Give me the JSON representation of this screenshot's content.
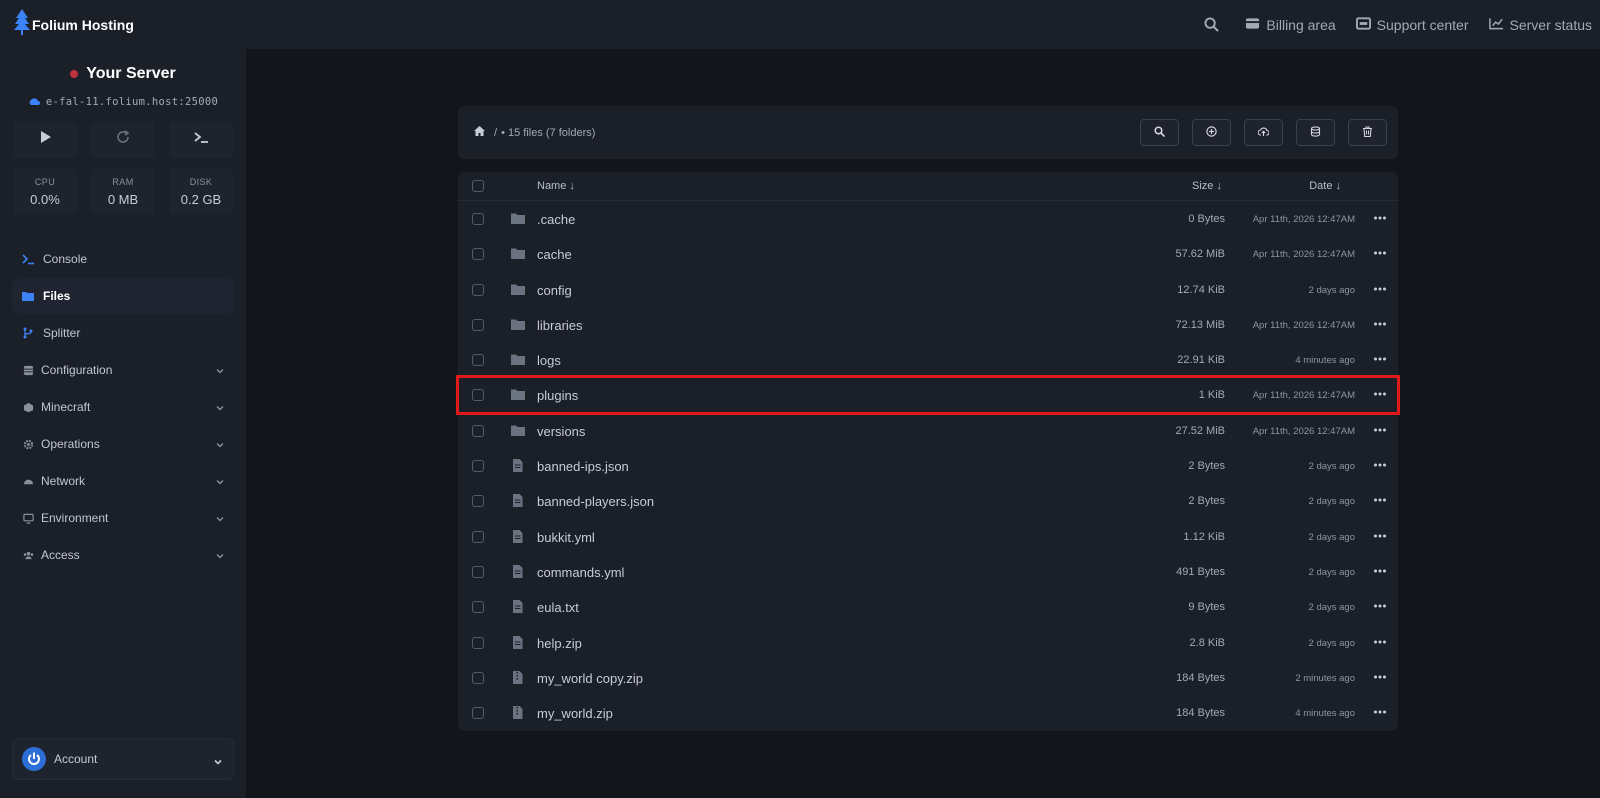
{
  "brand": {
    "name": "Folium Hosting",
    "accent_color": "#3b82f6"
  },
  "topnav": {
    "search_icon": "search-icon",
    "items": [
      {
        "label": "Billing area",
        "icon": "billing-icon"
      },
      {
        "label": "Support center",
        "icon": "support-icon"
      },
      {
        "label": "Server status",
        "icon": "status-chart-icon"
      }
    ]
  },
  "server": {
    "name": "Your Server",
    "status_color": "#c2303c",
    "address": "e-fal-11.folium.host:25000"
  },
  "power": {
    "start_icon": "play-icon",
    "restart_icon": "restart-icon",
    "console_icon": "terminal-icon"
  },
  "stats": [
    {
      "label": "CPU",
      "value": "0.0%"
    },
    {
      "label": "RAM",
      "value": "0 MB"
    },
    {
      "label": "DISK",
      "value": "0.2 GB"
    }
  ],
  "sidebar": {
    "items": [
      {
        "label": "Console",
        "icon": "terminal-icon"
      },
      {
        "label": "Files",
        "icon": "folder-icon"
      },
      {
        "label": "Splitter",
        "icon": "branch-icon"
      }
    ],
    "groups": [
      {
        "label": "Configuration",
        "icon": "database-icon"
      },
      {
        "label": "Minecraft",
        "icon": "minecraft-icon"
      },
      {
        "label": "Operations",
        "icon": "gear-icon"
      },
      {
        "label": "Network",
        "icon": "network-icon"
      },
      {
        "label": "Environment",
        "icon": "monitor-icon"
      },
      {
        "label": "Access",
        "icon": "users-icon"
      }
    ],
    "account_label": "Account"
  },
  "file_manager": {
    "breadcrumb_sep": "/",
    "summary": "• 15 files (7 folders)",
    "columns": {
      "name": "Name ↓",
      "size": "Size ↓",
      "date": "Date ↓"
    },
    "files": [
      {
        "name": ".cache",
        "type": "folder",
        "size": "0 Bytes",
        "date": "Apr 11th, 2026 12:47AM"
      },
      {
        "name": "cache",
        "type": "folder",
        "size": "57.62 MiB",
        "date": "Apr 11th, 2026 12:47AM"
      },
      {
        "name": "config",
        "type": "folder",
        "size": "12.74 KiB",
        "date": "2 days ago"
      },
      {
        "name": "libraries",
        "type": "folder",
        "size": "72.13 MiB",
        "date": "Apr 11th, 2026 12:47AM"
      },
      {
        "name": "logs",
        "type": "folder",
        "size": "22.91 KiB",
        "date": "4 minutes ago"
      },
      {
        "name": "plugins",
        "type": "folder",
        "size": "1 KiB",
        "date": "Apr 11th, 2026 12:47AM",
        "highlighted": true
      },
      {
        "name": "versions",
        "type": "folder",
        "size": "27.52 MiB",
        "date": "Apr 11th, 2026 12:47AM"
      },
      {
        "name": "banned-ips.json",
        "type": "file",
        "size": "2 Bytes",
        "date": "2 days ago"
      },
      {
        "name": "banned-players.json",
        "type": "file",
        "size": "2 Bytes",
        "date": "2 days ago"
      },
      {
        "name": "bukkit.yml",
        "type": "file",
        "size": "1.12 KiB",
        "date": "2 days ago"
      },
      {
        "name": "commands.yml",
        "type": "file",
        "size": "491 Bytes",
        "date": "2 days ago"
      },
      {
        "name": "eula.txt",
        "type": "file",
        "size": "9 Bytes",
        "date": "2 days ago"
      },
      {
        "name": "help.zip",
        "type": "file",
        "size": "2.8 KiB",
        "date": "2 days ago"
      },
      {
        "name": "my_world copy.zip",
        "type": "archive",
        "size": "184 Bytes",
        "date": "2 minutes ago"
      },
      {
        "name": "my_world.zip",
        "type": "archive",
        "size": "184 Bytes",
        "date": "4 minutes ago"
      }
    ]
  }
}
